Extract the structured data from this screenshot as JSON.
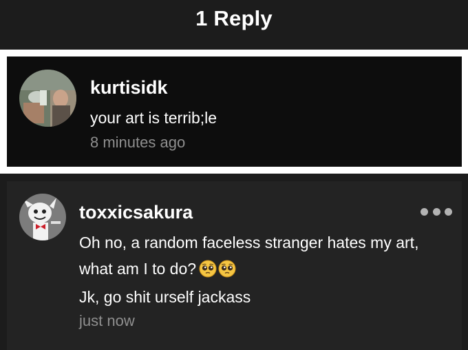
{
  "header": {
    "title": "1 Reply"
  },
  "parent_comment": {
    "username": "kurtisidk",
    "text": "your art is terrib;le",
    "timestamp": "8 minutes ago",
    "avatar": "user-photo-avatar"
  },
  "reply": {
    "username": "toxxicsakura",
    "line1": "Oh no, a random faceless stranger hates my art,",
    "line2": "what am I to do?",
    "line3": "Jk, go shit urself jackass",
    "timestamp": "just now",
    "avatar": "cartoon-character-avatar",
    "emojis": [
      "pleading-face-emoji",
      "pleading-face-emoji"
    ],
    "more_icon": "more-options-icon"
  },
  "colors": {
    "background": "#1c1c1c",
    "highlight_border": "#ffffff",
    "parent_card_bg": "#0d0d0d",
    "reply_card_bg": "#232323",
    "text": "#ffffff",
    "muted_text": "#8f8f8f"
  }
}
